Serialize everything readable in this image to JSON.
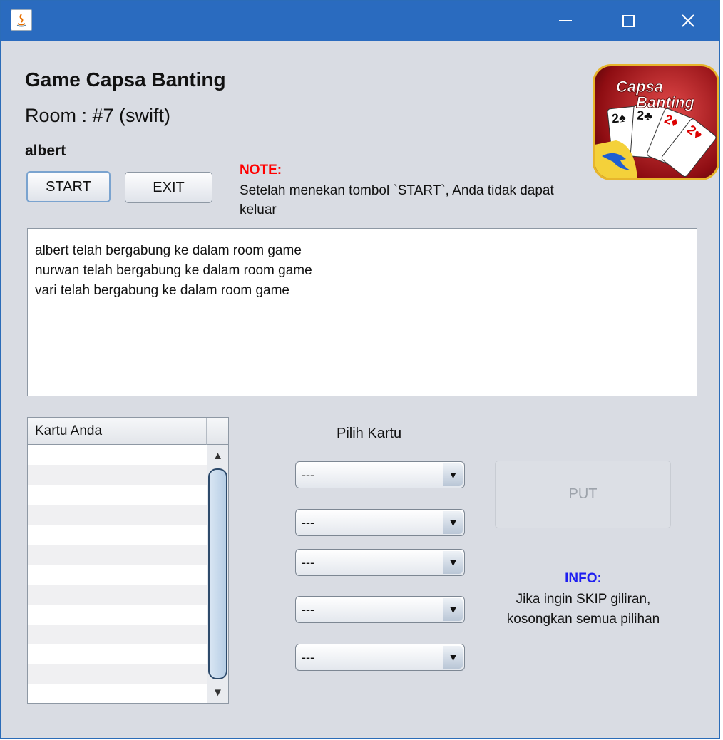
{
  "window": {
    "minimize_icon": "minimize-icon",
    "maximize_icon": "maximize-icon",
    "close_icon": "close-icon"
  },
  "header": {
    "title": "Game Capsa Banting",
    "room": "Room : #7 (swift)",
    "username": "albert"
  },
  "controls": {
    "start_label": "START",
    "exit_label": "EXIT"
  },
  "note": {
    "heading": "NOTE:",
    "text": "Setelah menekan tombol `START`, Anda tidak dapat keluar"
  },
  "logo": {
    "text_line1": "Capsa",
    "text_line2": "Banting",
    "card1": "2♠",
    "card2": "2♣",
    "card3": "2♦",
    "card4": "2♥"
  },
  "log": {
    "lines": [
      "albert telah bergabung ke dalam room game",
      "nurwan telah bergabung ke dalam room game",
      "vari telah bergabung ke dalam room game"
    ]
  },
  "cards_table": {
    "header": "Kartu Anda"
  },
  "select": {
    "label": "Pilih Kartu",
    "combos": [
      "---",
      "---",
      "---",
      "---",
      "---"
    ]
  },
  "put": {
    "label": "PUT"
  },
  "info": {
    "heading": "INFO:",
    "text": "Jika ingin SKIP giliran, kosongkan semua pilihan"
  },
  "colors": {
    "titlebar": "#2a6bbf",
    "background": "#d9dce3",
    "note": "#ff0000",
    "info": "#1e1ef0"
  }
}
